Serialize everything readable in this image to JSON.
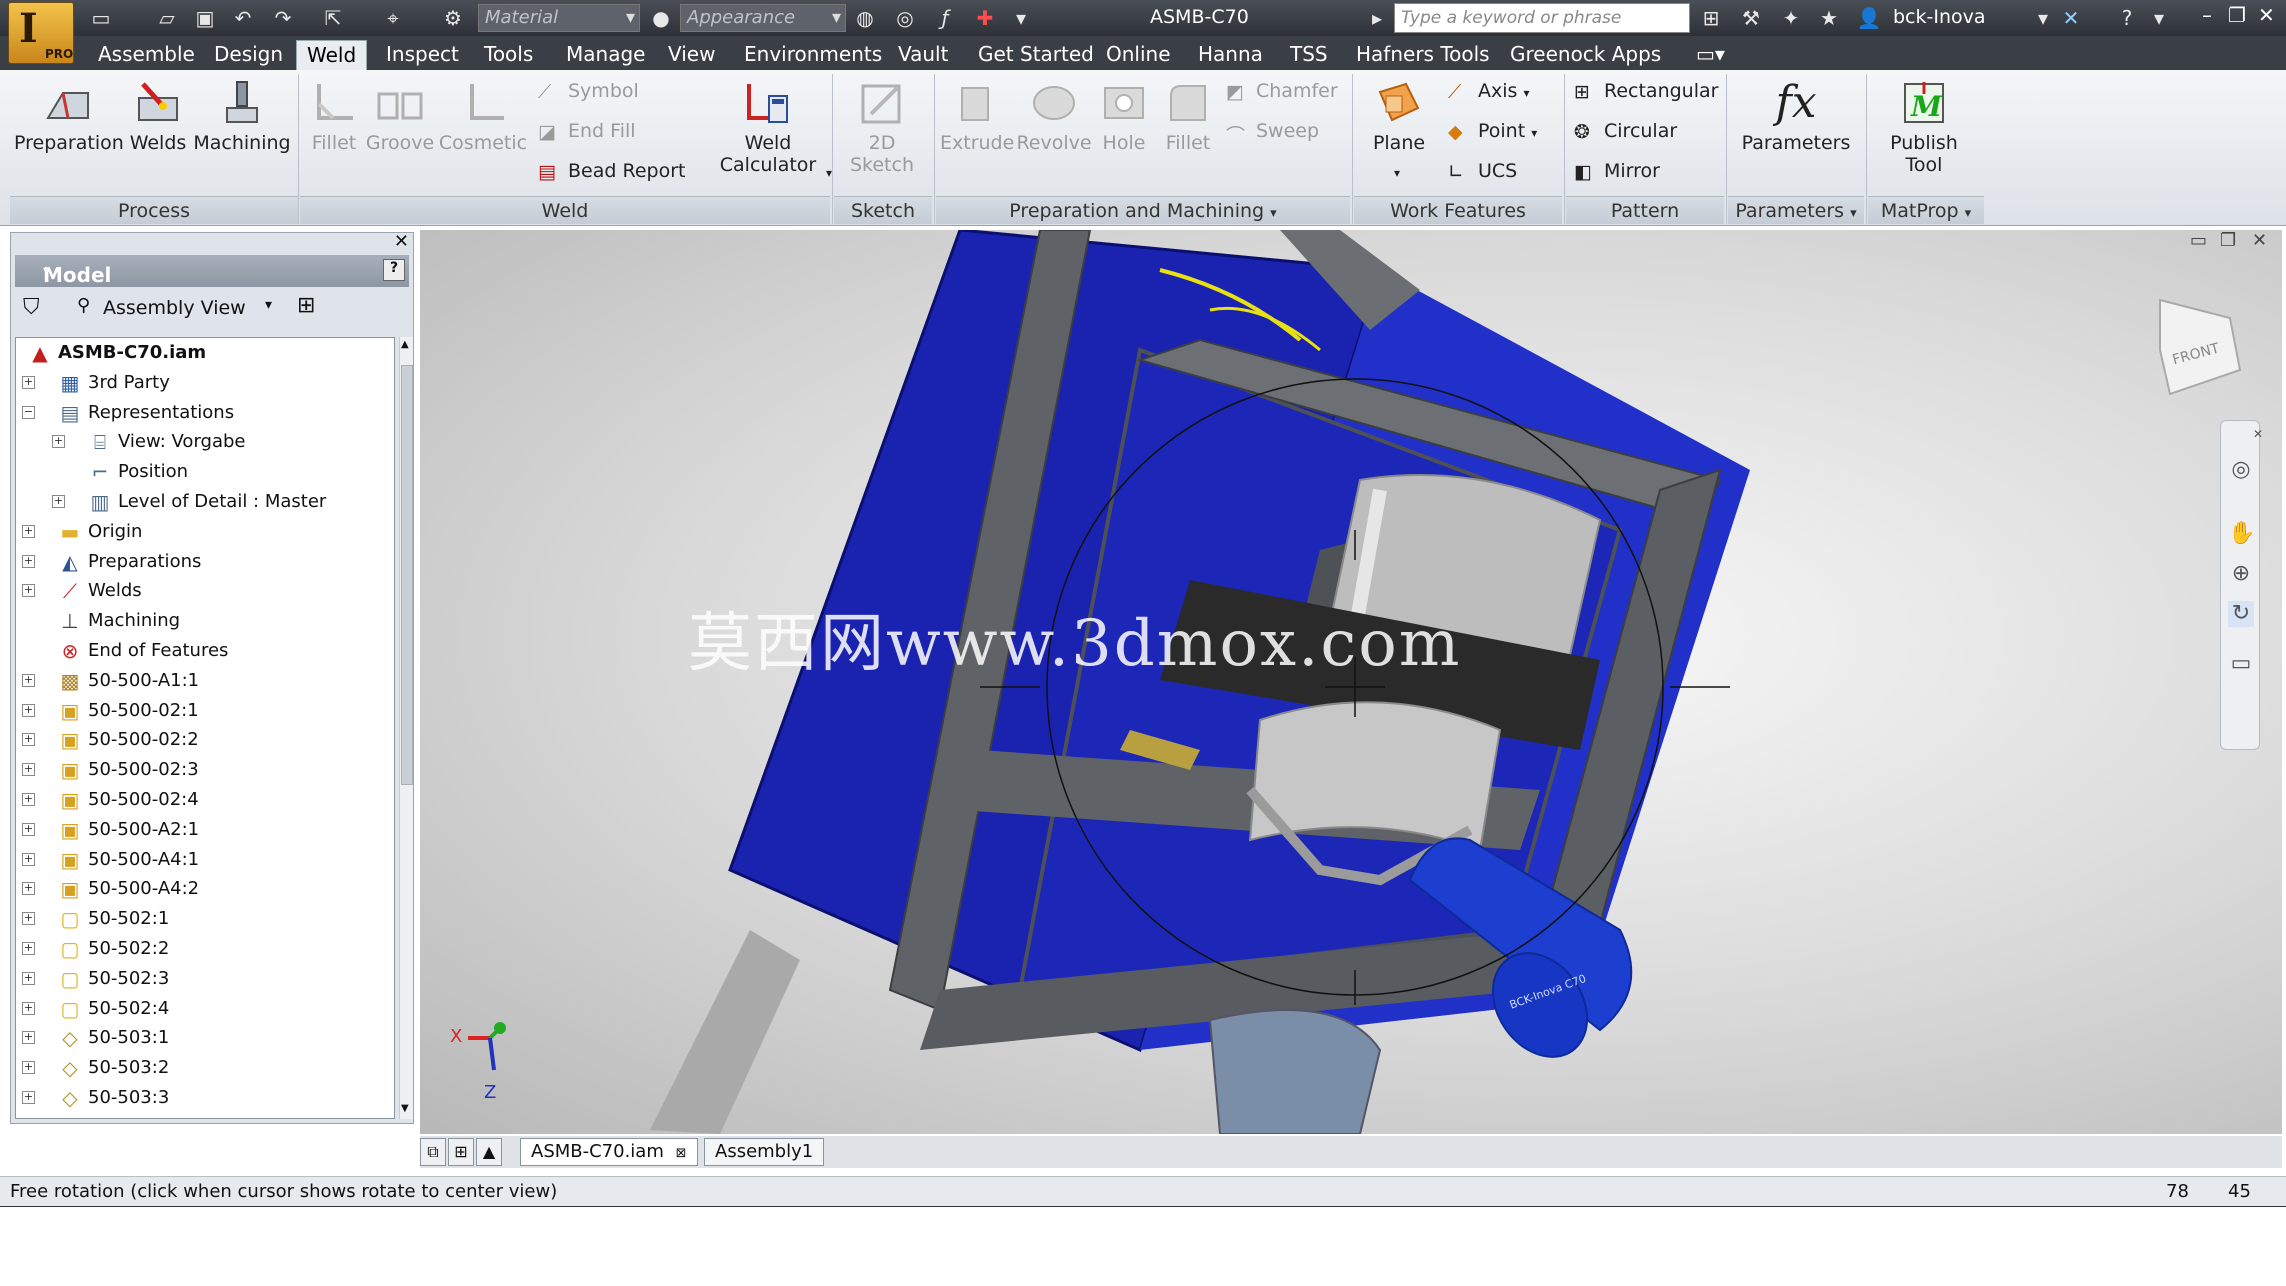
{
  "window": {
    "title": "ASMB-C70",
    "app_badge": "PRO",
    "user": "bck-Inova"
  },
  "quick_access": {
    "material_placeholder": "Material",
    "appearance_placeholder": "Appearance",
    "search_placeholder": "Type a keyword or phrase"
  },
  "menu_tabs": [
    "Assemble",
    "Design",
    "Weld",
    "Inspect",
    "Tools",
    "Manage",
    "View",
    "Environments",
    "Vault",
    "Get Started",
    "Online",
    "Hanna",
    "TSS",
    "Hafners Tools",
    "Greenock Apps"
  ],
  "active_tab": "Weld",
  "ribbon": {
    "process": {
      "label": "Process",
      "preparation": "Preparation",
      "welds": "Welds",
      "machining": "Machining"
    },
    "weld": {
      "label": "Weld",
      "fillet": "Fillet",
      "groove": "Groove",
      "cosmetic": "Cosmetic",
      "symbol": "Symbol",
      "end_fill": "End Fill",
      "bead_report": "Bead Report",
      "weld_calculator_1": "Weld",
      "weld_calculator_2": "Calculator"
    },
    "sketch": {
      "label": "Sketch",
      "sketch_2d": "2D Sketch"
    },
    "prep_machining": {
      "label": "Preparation and Machining",
      "extrude": "Extrude",
      "revolve": "Revolve",
      "hole": "Hole",
      "fillet": "Fillet",
      "chamfer": "Chamfer",
      "sweep": "Sweep"
    },
    "work_features": {
      "label": "Work Features",
      "plane": "Plane",
      "axis": "Axis",
      "point": "Point",
      "ucs": "UCS"
    },
    "pattern": {
      "label": "Pattern",
      "rectangular": "Rectangular",
      "circular": "Circular",
      "mirror": "Mirror"
    },
    "parameters": {
      "label": "Parameters",
      "parameters": "Parameters",
      "fx": "fx"
    },
    "matprop": {
      "label": "MatProp",
      "publish_1": "Publish",
      "publish_2": "Tool"
    }
  },
  "browser": {
    "header": "Model",
    "view_mode": "Assembly View",
    "tree": [
      {
        "label": "ASMB-C70.iam",
        "level": 0,
        "expander": "",
        "icon": "assembly-root-icon",
        "bold": true
      },
      {
        "label": "3rd Party",
        "level": 1,
        "expander": "+",
        "icon": "third-party-icon"
      },
      {
        "label": "Representations",
        "level": 1,
        "expander": "-",
        "icon": "representations-icon"
      },
      {
        "label": "View: Vorgabe",
        "level": 2,
        "expander": "+",
        "icon": "view-rep-icon"
      },
      {
        "label": "Position",
        "level": 2,
        "expander": "",
        "icon": "position-rep-icon"
      },
      {
        "label": "Level of Detail : Master",
        "level": 2,
        "expander": "+",
        "icon": "lod-icon"
      },
      {
        "label": "Origin",
        "level": 1,
        "expander": "+",
        "icon": "folder-icon"
      },
      {
        "label": "Preparations",
        "level": 1,
        "expander": "+",
        "icon": "preparations-icon"
      },
      {
        "label": "Welds",
        "level": 1,
        "expander": "+",
        "icon": "welds-icon"
      },
      {
        "label": "Machining",
        "level": 1,
        "expander": "",
        "icon": "machining-icon"
      },
      {
        "label": "End of Features",
        "level": 1,
        "expander": "",
        "icon": "end-of-features-icon"
      },
      {
        "label": "50-500-A1:1",
        "level": 1,
        "expander": "+",
        "icon": "weldment-icon"
      },
      {
        "label": "50-500-02:1",
        "level": 1,
        "expander": "+",
        "icon": "subassembly-icon"
      },
      {
        "label": "50-500-02:2",
        "level": 1,
        "expander": "+",
        "icon": "subassembly-icon"
      },
      {
        "label": "50-500-02:3",
        "level": 1,
        "expander": "+",
        "icon": "subassembly-icon"
      },
      {
        "label": "50-500-02:4",
        "level": 1,
        "expander": "+",
        "icon": "subassembly-icon"
      },
      {
        "label": "50-500-A2:1",
        "level": 1,
        "expander": "+",
        "icon": "subassembly-icon"
      },
      {
        "label": "50-500-A4:1",
        "level": 1,
        "expander": "+",
        "icon": "subassembly-icon"
      },
      {
        "label": "50-500-A4:2",
        "level": 1,
        "expander": "+",
        "icon": "subassembly-icon"
      },
      {
        "label": "50-502:1",
        "level": 1,
        "expander": "+",
        "icon": "part-icon"
      },
      {
        "label": "50-502:2",
        "level": 1,
        "expander": "+",
        "icon": "part-icon"
      },
      {
        "label": "50-502:3",
        "level": 1,
        "expander": "+",
        "icon": "part-icon"
      },
      {
        "label": "50-502:4",
        "level": 1,
        "expander": "+",
        "icon": "part-icon"
      },
      {
        "label": "50-503:1",
        "level": 1,
        "expander": "+",
        "icon": "content-part-icon"
      },
      {
        "label": "50-503:2",
        "level": 1,
        "expander": "+",
        "icon": "content-part-icon"
      },
      {
        "label": "50-503:3",
        "level": 1,
        "expander": "+",
        "icon": "content-part-icon"
      }
    ]
  },
  "viewport": {
    "watermark": "莫西网www.3dmox.com",
    "viewcube_face": "FRONT",
    "triad_x": "X",
    "triad_z": "Z",
    "tube_label": "BCK-Inova C70",
    "colors": {
      "panel_blue": "#1a22b0",
      "frame_gray": "#5f6266",
      "tube_blue": "#1c3fd0"
    }
  },
  "doc_tabs": [
    "ASMB-C70.iam",
    "Assembly1"
  ],
  "active_doc": "ASMB-C70.iam",
  "status": {
    "text": "Free rotation (click when cursor shows rotate to center view)",
    "num1": "78",
    "num2": "45"
  }
}
